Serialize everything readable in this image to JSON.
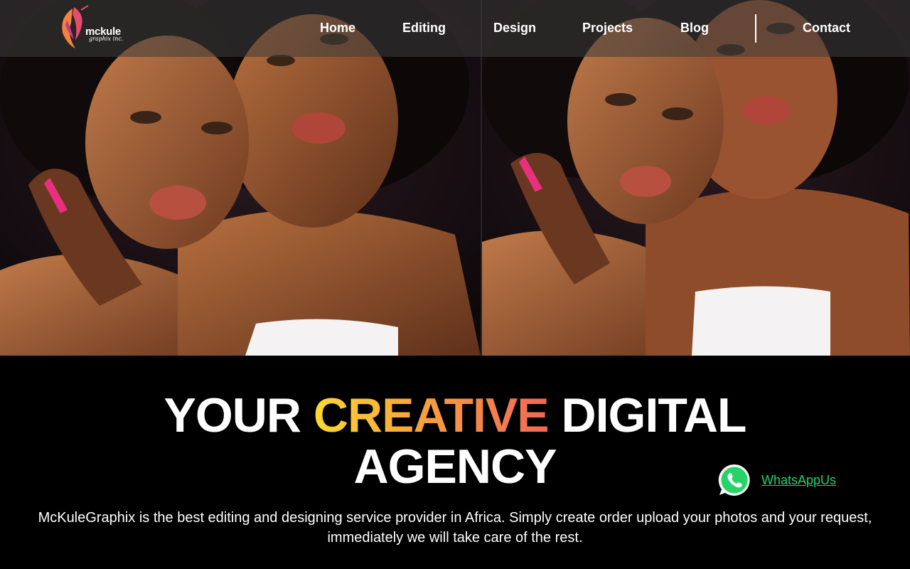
{
  "brand": {
    "name": "mckule",
    "tagline": "graphix inc.",
    "accent_colors": [
      "#f5823b",
      "#e84c6c",
      "#c23b8f"
    ]
  },
  "nav": {
    "items": [
      {
        "label": "Home"
      },
      {
        "label": "Editing"
      },
      {
        "label": "Design"
      },
      {
        "label": "Projects"
      },
      {
        "label": "Blog"
      },
      {
        "label": "Contact"
      }
    ]
  },
  "hero": {
    "headline_part1": "YOUR ",
    "headline_highlight": "CREATIVE",
    "headline_part2": " DIGITAL",
    "headline_line2": "AGENCY",
    "gradient_colors": [
      "#fbd833",
      "#f7a23c",
      "#f0665a"
    ],
    "description": "McKuleGraphix is the best editing and designing service provider in Africa. Simply create order upload your photos and your request, immediately we will take care of the rest."
  },
  "whatsapp": {
    "label": "WhatsAppUs",
    "icon": "whatsapp-icon",
    "color": "#25d366"
  }
}
